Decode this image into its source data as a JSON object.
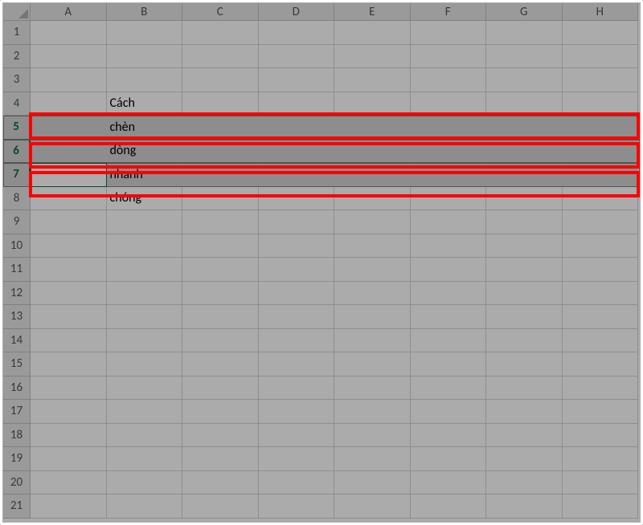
{
  "columns": [
    "A",
    "B",
    "C",
    "D",
    "E",
    "F",
    "G",
    "H"
  ],
  "rows": [
    1,
    2,
    3,
    4,
    5,
    6,
    7,
    8,
    9,
    10,
    11,
    12,
    13,
    14,
    15,
    16,
    17,
    18,
    19,
    20,
    21
  ],
  "selected_rows": [
    5,
    6,
    7
  ],
  "active_cell": {
    "row": 7,
    "col": "A"
  },
  "cells": {
    "B4": "Cách",
    "B5": "chèn",
    "B6": "dòng",
    "B7": "nhanh",
    "B8": "chóng"
  },
  "highlight_color": "#ff0000",
  "selection_accent": "#0f6b3a"
}
